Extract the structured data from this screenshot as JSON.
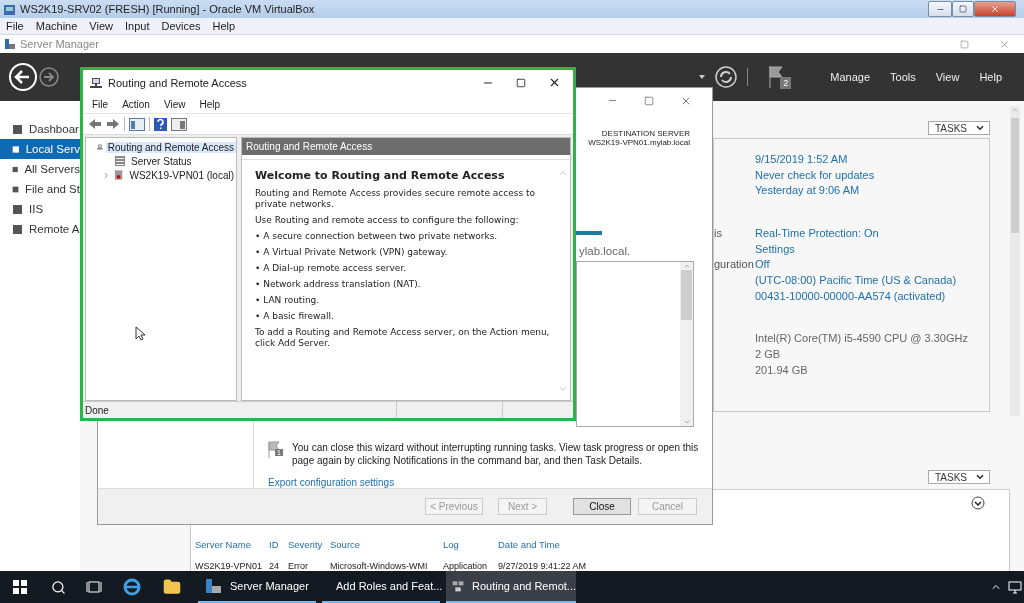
{
  "vbox": {
    "title": "WS2K19-SRV02 (FRESH) [Running] - Oracle VM VirtualBox",
    "menu": [
      "File",
      "Machine",
      "View",
      "Input",
      "Devices",
      "Help"
    ]
  },
  "server_manager": {
    "title": "Server Manager",
    "header_menu": [
      "Manage",
      "Tools",
      "View",
      "Help"
    ],
    "notification_count": "2",
    "sidebar": [
      {
        "label": "Dashboar",
        "selected": false
      },
      {
        "label": "Local Serv",
        "selected": true
      },
      {
        "label": "All Servers",
        "selected": false
      },
      {
        "label": "File and St",
        "selected": false
      },
      {
        "label": "IIS",
        "selected": false
      },
      {
        "label": "Remote A",
        "selected": false
      }
    ],
    "properties": {
      "tasks": "TASKS",
      "groups": [
        [
          {
            "value": "9/15/2019 1:52 AM",
            "kind": "link"
          },
          {
            "value": "Never check for updates",
            "kind": "link"
          },
          {
            "value": "Yesterday at 9:06 AM",
            "kind": "link"
          }
        ],
        [
          {
            "label": "is",
            "value": "Real-Time Protection: On",
            "kind": "link"
          },
          {
            "value": "Settings",
            "kind": "link"
          },
          {
            "label": "guration",
            "value": "Off",
            "kind": "link"
          },
          {
            "value": "(UTC-08:00) Pacific Time (US & Canada)",
            "kind": "link"
          },
          {
            "value": "00431-10000-00000-AA574 (activated)",
            "kind": "link"
          }
        ],
        [
          {
            "value": "Intel(R) Core(TM) i5-4590 CPU @ 3.30GHz",
            "kind": "text"
          },
          {
            "value": "2 GB",
            "kind": "text"
          },
          {
            "value": "201.94 GB",
            "kind": "text"
          }
        ]
      ]
    },
    "events": {
      "tasks": "TASKS",
      "columns": [
        "Server Name",
        "ID",
        "Severity",
        "Source",
        "Log",
        "Date and Time"
      ],
      "rows": [
        [
          "WS2K19-VPN01",
          "24",
          "Error",
          "Microsoft-Windows-WMI",
          "Application",
          "9/27/2019 9:41:22 AM"
        ]
      ]
    }
  },
  "wizard": {
    "destination_label": "DESTINATION SERVER",
    "destination_server": "WS2K19-VPN01.mylab.local",
    "progress": {
      "level": 1
    },
    "result_text": "ylab.local.",
    "notice_count": "1",
    "notice": "You can close this wizard without interrupting running tasks. View task progress or open this page again by clicking Notifications in the command bar, and then Task Details.",
    "export_link": "Export configuration settings",
    "buttons": [
      {
        "label": "< Previous",
        "disabled": true
      },
      {
        "label": "Next >",
        "disabled": true
      },
      {
        "label": "Close",
        "disabled": false
      },
      {
        "label": "Cancel",
        "disabled": true
      }
    ]
  },
  "rras": {
    "title": "Routing and Remote Access",
    "menu": [
      "File",
      "Action",
      "View",
      "Help"
    ],
    "tree": [
      {
        "label": "Routing and Remote Access",
        "selected": true,
        "kind": "root",
        "children": [
          {
            "label": "Server Status",
            "selected": false,
            "kind": "status"
          },
          {
            "label": "WS2K19-VPN01 (local)",
            "selected": false,
            "kind": "server",
            "expanded": false
          }
        ]
      }
    ],
    "pane_title": "Routing and Remote Access",
    "welcome": {
      "heading": "Welcome to Routing and Remote Access",
      "paragraphs": [
        "Routing and Remote Access provides secure remote access to private networks.",
        "Use Routing and remote access to configure the following:"
      ],
      "bullets": [
        "• A secure connection between two private networks.",
        "• A Virtual Private Network (VPN) gateway.",
        "• A Dial-up remote access server.",
        "• Network address translation (NAT).",
        "• LAN routing.",
        "• A basic firewall."
      ],
      "footer": "To add a Routing and Remote Access server, on the Action menu, click Add Server."
    },
    "status": "Done"
  },
  "taskbar": {
    "apps": [
      {
        "label": "Server Manager",
        "selected": false
      },
      {
        "label": "Add Roles and Feat...",
        "selected": false
      },
      {
        "label": "Routing and Remot...",
        "selected": true
      }
    ]
  }
}
